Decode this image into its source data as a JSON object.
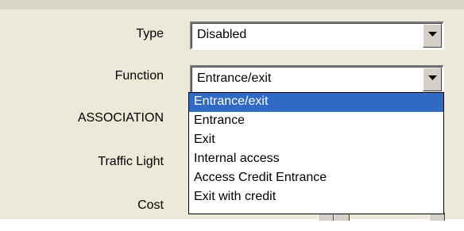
{
  "form": {
    "type_label": "Type",
    "type_value": "Disabled",
    "function_label": "Function",
    "function_value": "Entrance/exit",
    "association_label": "ASSOCIATION",
    "traffic_light_label": "Traffic Light",
    "cost_label": "Cost"
  },
  "dropdown": {
    "options": [
      "Entrance/exit",
      "Entrance",
      "Exit",
      "Internal access",
      "Access Credit Entrance",
      "Exit with credit"
    ],
    "selected_index": 0,
    "highlight_color": "#316ac5"
  },
  "icons": {
    "combo_arrow": "chevron-down-icon"
  }
}
